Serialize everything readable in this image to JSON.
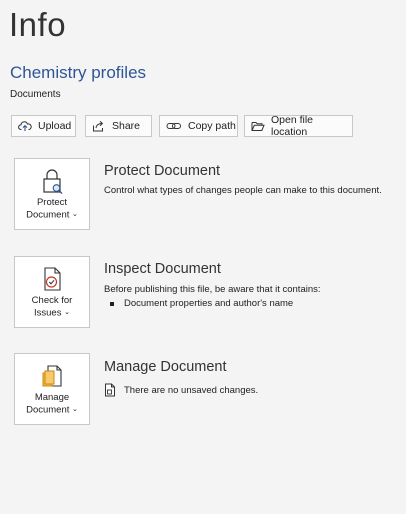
{
  "header": {
    "title": "Info",
    "document_name": "Chemistry profiles",
    "location": "Documents"
  },
  "actions": {
    "upload": "Upload",
    "share": "Share",
    "copy_path": "Copy path",
    "open_file_location": "Open file location"
  },
  "protect": {
    "tile_line1": "Protect",
    "tile_line2": "Document",
    "heading": "Protect Document",
    "description": "Control what types of changes people can make to this document."
  },
  "inspect": {
    "tile_line1": "Check for",
    "tile_line2": "Issues",
    "heading": "Inspect Document",
    "description": "Before publishing this file, be aware that it contains:",
    "items": [
      "Document properties and author's name"
    ]
  },
  "manage": {
    "tile_line1": "Manage",
    "tile_line2": "Document",
    "heading": "Manage Document",
    "status": "There are no unsaved changes."
  },
  "colors": {
    "accent": "#2f5597",
    "background": "#f4f4f4"
  },
  "icons": {
    "upload": "cloud-upload-icon",
    "share": "share-icon",
    "copy_path": "link-icon",
    "open_file_location": "folder-icon",
    "protect": "lock-icon",
    "inspect": "check-document-icon",
    "manage": "manage-document-icon",
    "status": "document-icon"
  },
  "dropdown_glyph": "⌄"
}
